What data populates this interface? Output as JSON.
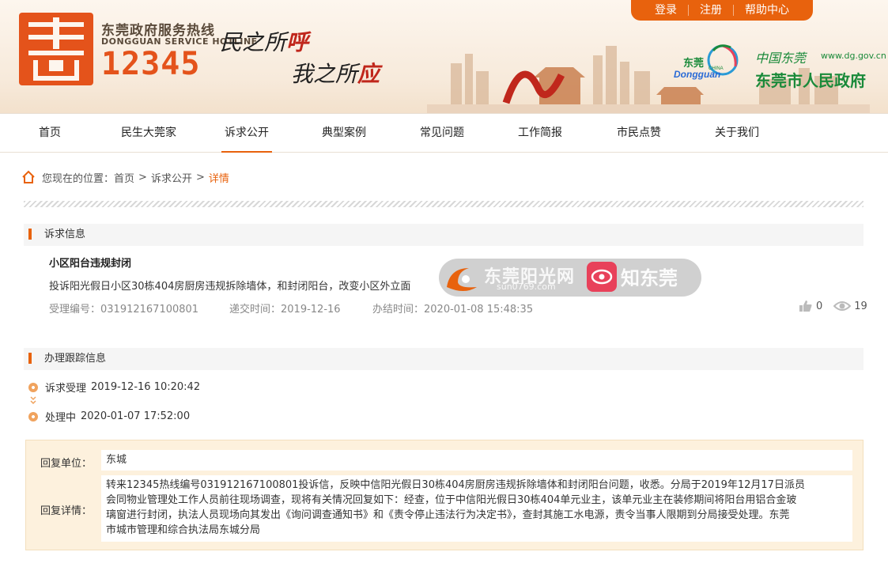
{
  "header": {
    "hotline_cn": "东莞政府服务热线",
    "hotline_en": "DONGGUAN SERVICE HOTLINE",
    "hotline_number": "12345",
    "slogan1_a": "民之所",
    "slogan1_b": "呼",
    "slogan2_a": "我之所",
    "slogan2_b": "应",
    "top_links": [
      "登录",
      "注册",
      "帮助中心"
    ],
    "gov_logo_text": "东莞",
    "gov_logo_sub": "CHINA",
    "gov_logo_en": "Dongguan",
    "gov_cn_small": "中国东莞",
    "gov_url": "www.dg.gov.cn",
    "gov_name": "东莞市人民政府"
  },
  "nav": {
    "items": [
      "首页",
      "民生大莞家",
      "诉求公开",
      "典型案例",
      "常见问题",
      "工作简报",
      "市民点赞",
      "关于我们"
    ],
    "active": "诉求公开"
  },
  "breadcrumb": {
    "prefix": "您现在的位置：",
    "items": [
      "首页",
      "诉求公开",
      "详情"
    ]
  },
  "appeal": {
    "section_title": "诉求信息",
    "title": "小区阳台违规封闭",
    "content": "投诉阳光假日小区30栋404房厨房违规拆除墙体，和封闭阳台，改变小区外立面",
    "ref_label": "受理编号：",
    "ref": "031912167100801",
    "submit_label": "递交时间：",
    "submit_time": "2019-12-16",
    "done_label": "办结时间：",
    "done_time": "2020-01-08 15:48:35",
    "likes": "0",
    "views": "19"
  },
  "watermark": {
    "text1": "东莞阳光网",
    "sub": "sun0769.com",
    "text2": "知东莞"
  },
  "tracking": {
    "section_title": "办理跟踪信息",
    "steps": [
      {
        "label": "诉求受理",
        "time": "2019-12-16 10:20:42"
      },
      {
        "label": "处理中",
        "time": "2020-01-07 17:52:00"
      }
    ]
  },
  "reply": {
    "unit_label": "回复单位：",
    "unit": "东城",
    "detail_label": "回复详情：",
    "detail_lines": [
      "转来12345热线编号031912167100801投诉信，反映中信阳光假日30栋404房厨房违规拆除墙体和封闭阳台问题，收悉。分局于2019年12月17日派员",
      "会同物业管理处工作人员前往现场调查，现将有关情况回复如下：经查，位于中信阳光假日30栋404单元业主，该单元业主在装修期间将阳台用铝合金玻",
      "璃窗进行封闭，执法人员现场向其发出《询问调查通知书》和《责令停止违法行为决定书》，查封其施工水电源，责令当事人限期到分局接受处理。东莞",
      "市城市管理和综合执法局东城分局"
    ]
  },
  "colors": {
    "accent": "#e8620d",
    "brand_red": "#e4531b",
    "gov_green": "#1a8a3a",
    "reply_bg": "#fdf1dd"
  }
}
